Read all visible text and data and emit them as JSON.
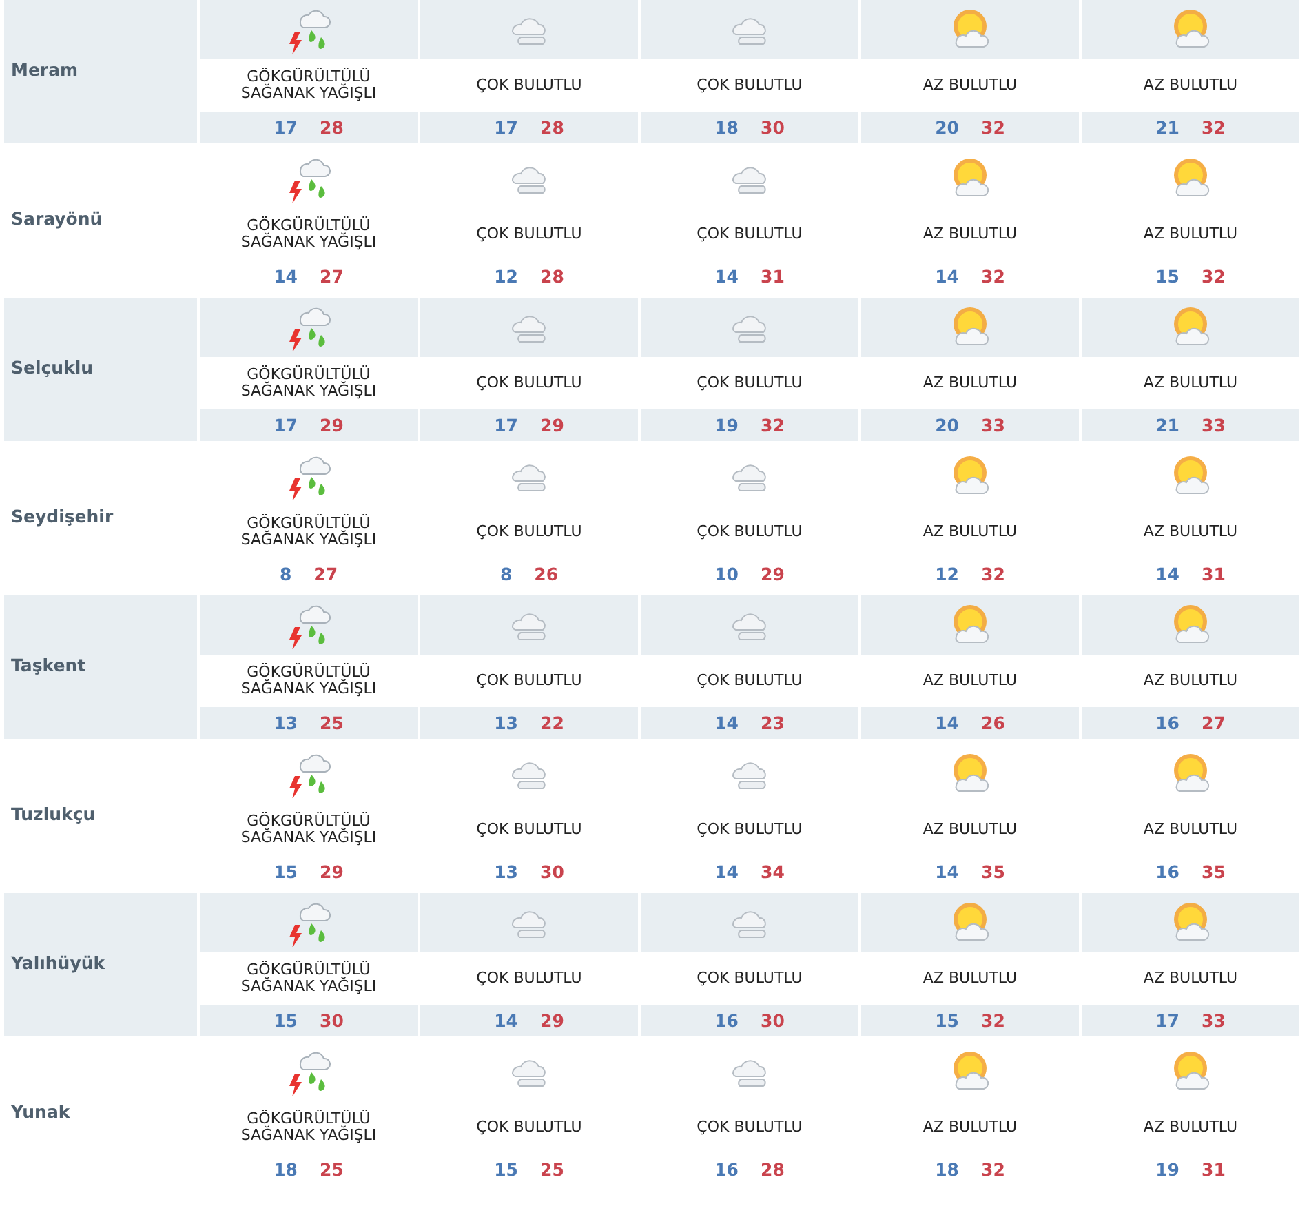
{
  "cities": [
    {
      "name": "Meram",
      "days": [
        {
          "kind": "storm",
          "condition": "GÖKGÜRÜLTÜLÜ SAĞANAK YAĞIŞLI",
          "low": "17",
          "high": "28"
        },
        {
          "kind": "cloudy",
          "condition": "ÇOK BULUTLU",
          "low": "17",
          "high": "28"
        },
        {
          "kind": "cloudy",
          "condition": "ÇOK BULUTLU",
          "low": "18",
          "high": "30"
        },
        {
          "kind": "partly",
          "condition": "AZ BULUTLU",
          "low": "20",
          "high": "32"
        },
        {
          "kind": "partly",
          "condition": "AZ BULUTLU",
          "low": "21",
          "high": "32"
        }
      ]
    },
    {
      "name": "Sarayönü",
      "days": [
        {
          "kind": "storm",
          "condition": "GÖKGÜRÜLTÜLÜ SAĞANAK YAĞIŞLI",
          "low": "14",
          "high": "27"
        },
        {
          "kind": "cloudy",
          "condition": "ÇOK BULUTLU",
          "low": "12",
          "high": "28"
        },
        {
          "kind": "cloudy",
          "condition": "ÇOK BULUTLU",
          "low": "14",
          "high": "31"
        },
        {
          "kind": "partly",
          "condition": "AZ BULUTLU",
          "low": "14",
          "high": "32"
        },
        {
          "kind": "partly",
          "condition": "AZ BULUTLU",
          "low": "15",
          "high": "32"
        }
      ]
    },
    {
      "name": "Selçuklu",
      "days": [
        {
          "kind": "storm",
          "condition": "GÖKGÜRÜLTÜLÜ SAĞANAK YAĞIŞLI",
          "low": "17",
          "high": "29"
        },
        {
          "kind": "cloudy",
          "condition": "ÇOK BULUTLU",
          "low": "17",
          "high": "29"
        },
        {
          "kind": "cloudy",
          "condition": "ÇOK BULUTLU",
          "low": "19",
          "high": "32"
        },
        {
          "kind": "partly",
          "condition": "AZ BULUTLU",
          "low": "20",
          "high": "33"
        },
        {
          "kind": "partly",
          "condition": "AZ BULUTLU",
          "low": "21",
          "high": "33"
        }
      ]
    },
    {
      "name": "Seydişehir",
      "days": [
        {
          "kind": "storm",
          "condition": "GÖKGÜRÜLTÜLÜ SAĞANAK YAĞIŞLI",
          "low": "8",
          "high": "27"
        },
        {
          "kind": "cloudy",
          "condition": "ÇOK BULUTLU",
          "low": "8",
          "high": "26"
        },
        {
          "kind": "cloudy",
          "condition": "ÇOK BULUTLU",
          "low": "10",
          "high": "29"
        },
        {
          "kind": "partly",
          "condition": "AZ BULUTLU",
          "low": "12",
          "high": "32"
        },
        {
          "kind": "partly",
          "condition": "AZ BULUTLU",
          "low": "14",
          "high": "31"
        }
      ]
    },
    {
      "name": "Taşkent",
      "days": [
        {
          "kind": "storm",
          "condition": "GÖKGÜRÜLTÜLÜ SAĞANAK YAĞIŞLI",
          "low": "13",
          "high": "25"
        },
        {
          "kind": "cloudy",
          "condition": "ÇOK BULUTLU",
          "low": "13",
          "high": "22"
        },
        {
          "kind": "cloudy",
          "condition": "ÇOK BULUTLU",
          "low": "14",
          "high": "23"
        },
        {
          "kind": "partly",
          "condition": "AZ BULUTLU",
          "low": "14",
          "high": "26"
        },
        {
          "kind": "partly",
          "condition": "AZ BULUTLU",
          "low": "16",
          "high": "27"
        }
      ]
    },
    {
      "name": "Tuzlukçu",
      "days": [
        {
          "kind": "storm",
          "condition": "GÖKGÜRÜLTÜLÜ SAĞANAK YAĞIŞLI",
          "low": "15",
          "high": "29"
        },
        {
          "kind": "cloudy",
          "condition": "ÇOK BULUTLU",
          "low": "13",
          "high": "30"
        },
        {
          "kind": "cloudy",
          "condition": "ÇOK BULUTLU",
          "low": "14",
          "high": "34"
        },
        {
          "kind": "partly",
          "condition": "AZ BULUTLU",
          "low": "14",
          "high": "35"
        },
        {
          "kind": "partly",
          "condition": "AZ BULUTLU",
          "low": "16",
          "high": "35"
        }
      ]
    },
    {
      "name": "Yalıhüyük",
      "days": [
        {
          "kind": "storm",
          "condition": "GÖKGÜRÜLTÜLÜ SAĞANAK YAĞIŞLI",
          "low": "15",
          "high": "30"
        },
        {
          "kind": "cloudy",
          "condition": "ÇOK BULUTLU",
          "low": "14",
          "high": "29"
        },
        {
          "kind": "cloudy",
          "condition": "ÇOK BULUTLU",
          "low": "16",
          "high": "30"
        },
        {
          "kind": "partly",
          "condition": "AZ BULUTLU",
          "low": "15",
          "high": "32"
        },
        {
          "kind": "partly",
          "condition": "AZ BULUTLU",
          "low": "17",
          "high": "33"
        }
      ]
    },
    {
      "name": "Yunak",
      "days": [
        {
          "kind": "storm",
          "condition": "GÖKGÜRÜLTÜLÜ SAĞANAK YAĞIŞLI",
          "low": "18",
          "high": "25"
        },
        {
          "kind": "cloudy",
          "condition": "ÇOK BULUTLU",
          "low": "15",
          "high": "25"
        },
        {
          "kind": "cloudy",
          "condition": "ÇOK BULUTLU",
          "low": "16",
          "high": "28"
        },
        {
          "kind": "partly",
          "condition": "AZ BULUTLU",
          "low": "18",
          "high": "32"
        },
        {
          "kind": "partly",
          "condition": "AZ BULUTLU",
          "low": "19",
          "high": "31"
        }
      ]
    }
  ]
}
